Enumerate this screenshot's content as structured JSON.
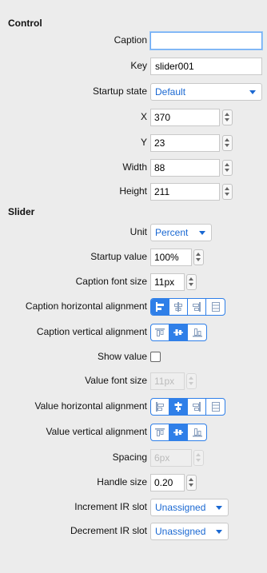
{
  "control": {
    "title": "Control",
    "caption": {
      "label": "Caption",
      "value": ""
    },
    "key": {
      "label": "Key",
      "value": "slider001"
    },
    "startup_state": {
      "label": "Startup state",
      "value": "Default"
    },
    "x": {
      "label": "X",
      "value": "370"
    },
    "y": {
      "label": "Y",
      "value": "23"
    },
    "width": {
      "label": "Width",
      "value": "88"
    },
    "height": {
      "label": "Height",
      "value": "211"
    }
  },
  "slider": {
    "title": "Slider",
    "unit": {
      "label": "Unit",
      "value": "Percent"
    },
    "startup_value": {
      "label": "Startup value",
      "value": "100%"
    },
    "caption_font_size": {
      "label": "Caption font size",
      "value": "11px"
    },
    "caption_h_align": {
      "label": "Caption horizontal alignment",
      "selected": "left"
    },
    "caption_v_align": {
      "label": "Caption vertical alignment",
      "selected": "center"
    },
    "show_value": {
      "label": "Show value",
      "checked": false
    },
    "value_font_size": {
      "label": "Value font size",
      "value": "11px"
    },
    "value_h_align": {
      "label": "Value horizontal alignment",
      "selected": "center"
    },
    "value_v_align": {
      "label": "Value vertical alignment",
      "selected": "center"
    },
    "spacing": {
      "label": "Spacing",
      "value": "6px"
    },
    "handle_size": {
      "label": "Handle size",
      "value": "0.20"
    },
    "increment_ir_slot": {
      "label": "Increment IR slot",
      "value": "Unassigned"
    },
    "decrement_ir_slot": {
      "label": "Decrement IR slot",
      "value": "Unassigned"
    }
  },
  "colors": {
    "accent": "#2f7fe8",
    "dropdown_text": "#1a68d2",
    "panel_background": "#ececec"
  },
  "icons": {
    "align_left": "align-left-icon",
    "align_center": "align-center-icon",
    "align_right": "align-right-icon",
    "align_justify": "align-justify-icon",
    "valign_top": "valign-top-icon",
    "valign_middle": "valign-middle-icon",
    "valign_bottom": "valign-bottom-icon"
  }
}
